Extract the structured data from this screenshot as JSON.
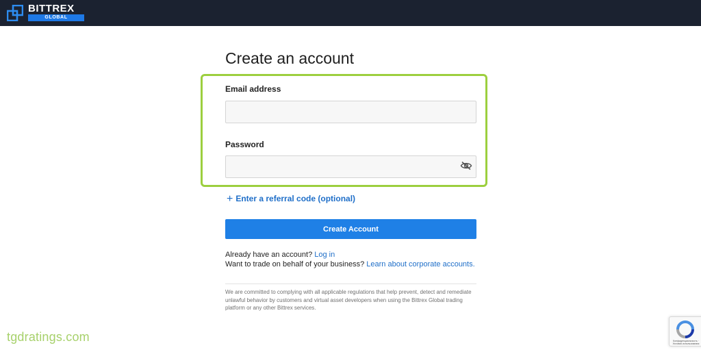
{
  "header": {
    "brand": "BITTREX",
    "brand_sub": "GLOBAL"
  },
  "form": {
    "title": "Create an account",
    "email_label": "Email address",
    "email_value": "",
    "password_label": "Password",
    "password_value": "",
    "referral_link": "Enter a referral code (optional)",
    "submit_label": "Create Account"
  },
  "footer": {
    "have_account_text": "Already have an account?",
    "login_link": "Log in",
    "business_text": "Want to trade on behalf of your business?",
    "corporate_link": "Learn about corporate accounts.",
    "disclaimer": "We are committed to complying with all applicable regulations that help prevent, detect and remediate unlawful behavior by customers and virtual asset developers when using the Bittrex Global trading platform or any other Bittrex services."
  },
  "watermark": "tgdratings.com",
  "recaptcha": {
    "footer_text": "Конфиденциальность · Условия использования"
  },
  "colors": {
    "topbar": "#1b2230",
    "accent_blue": "#1f80e6",
    "highlight_green": "#9ccf3e",
    "link_blue": "#1e6ec8"
  },
  "icons": {
    "logo": "bittrex-logo-icon",
    "password_toggle": "eye-slash-icon",
    "referral": "plus-icon",
    "recaptcha": "recaptcha-icon"
  }
}
